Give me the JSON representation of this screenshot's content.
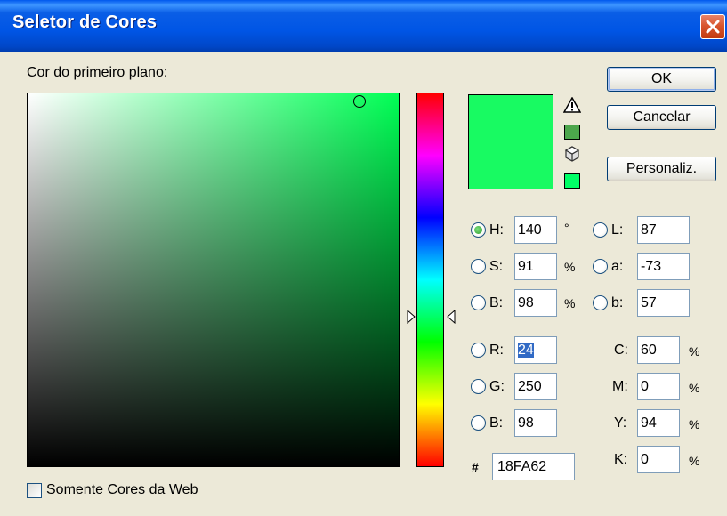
{
  "window": {
    "title": "Seletor de Cores",
    "close_icon": "close-x-icon"
  },
  "labels": {
    "foreground": "Cor do primeiro plano:"
  },
  "buttons": {
    "ok": "OK",
    "cancel": "Cancelar",
    "custom": "Personaliz."
  },
  "colors": {
    "picked": "#18FA62",
    "field_hue": "#00FF55",
    "web_safe": "#00FF66",
    "gamut_warning": "#4CA64C"
  },
  "icons": {
    "gamut_warning": "warning-triangle-icon",
    "web_safe": "cube-icon"
  },
  "hsb": [
    {
      "key": "H",
      "label": "H:",
      "value": "140",
      "unit": "°",
      "selected": true
    },
    {
      "key": "S",
      "label": "S:",
      "value": "91",
      "unit": "%",
      "selected": false
    },
    {
      "key": "B",
      "label": "B:",
      "value": "98",
      "unit": "%",
      "selected": false
    }
  ],
  "rgb": [
    {
      "key": "R",
      "label": "R:",
      "value": "24",
      "selected": false
    },
    {
      "key": "G",
      "label": "G:",
      "value": "250",
      "selected": false
    },
    {
      "key": "B",
      "label": "B:",
      "value": "98",
      "selected": false
    }
  ],
  "lab": [
    {
      "key": "L",
      "label": "L:",
      "value": "87"
    },
    {
      "key": "a",
      "label": "a:",
      "value": "-73"
    },
    {
      "key": "b",
      "label": "b:",
      "value": "57"
    }
  ],
  "cmyk": [
    {
      "key": "C",
      "label": "C:",
      "value": "60",
      "unit": "%"
    },
    {
      "key": "M",
      "label": "M:",
      "value": "0",
      "unit": "%"
    },
    {
      "key": "Y",
      "label": "Y:",
      "value": "94",
      "unit": "%"
    },
    {
      "key": "K",
      "label": "K:",
      "value": "0",
      "unit": "%"
    }
  ],
  "hex": {
    "symbol": "#",
    "value": "18FA62"
  },
  "web_only": {
    "label": "Somente Cores da Web",
    "checked": false
  }
}
